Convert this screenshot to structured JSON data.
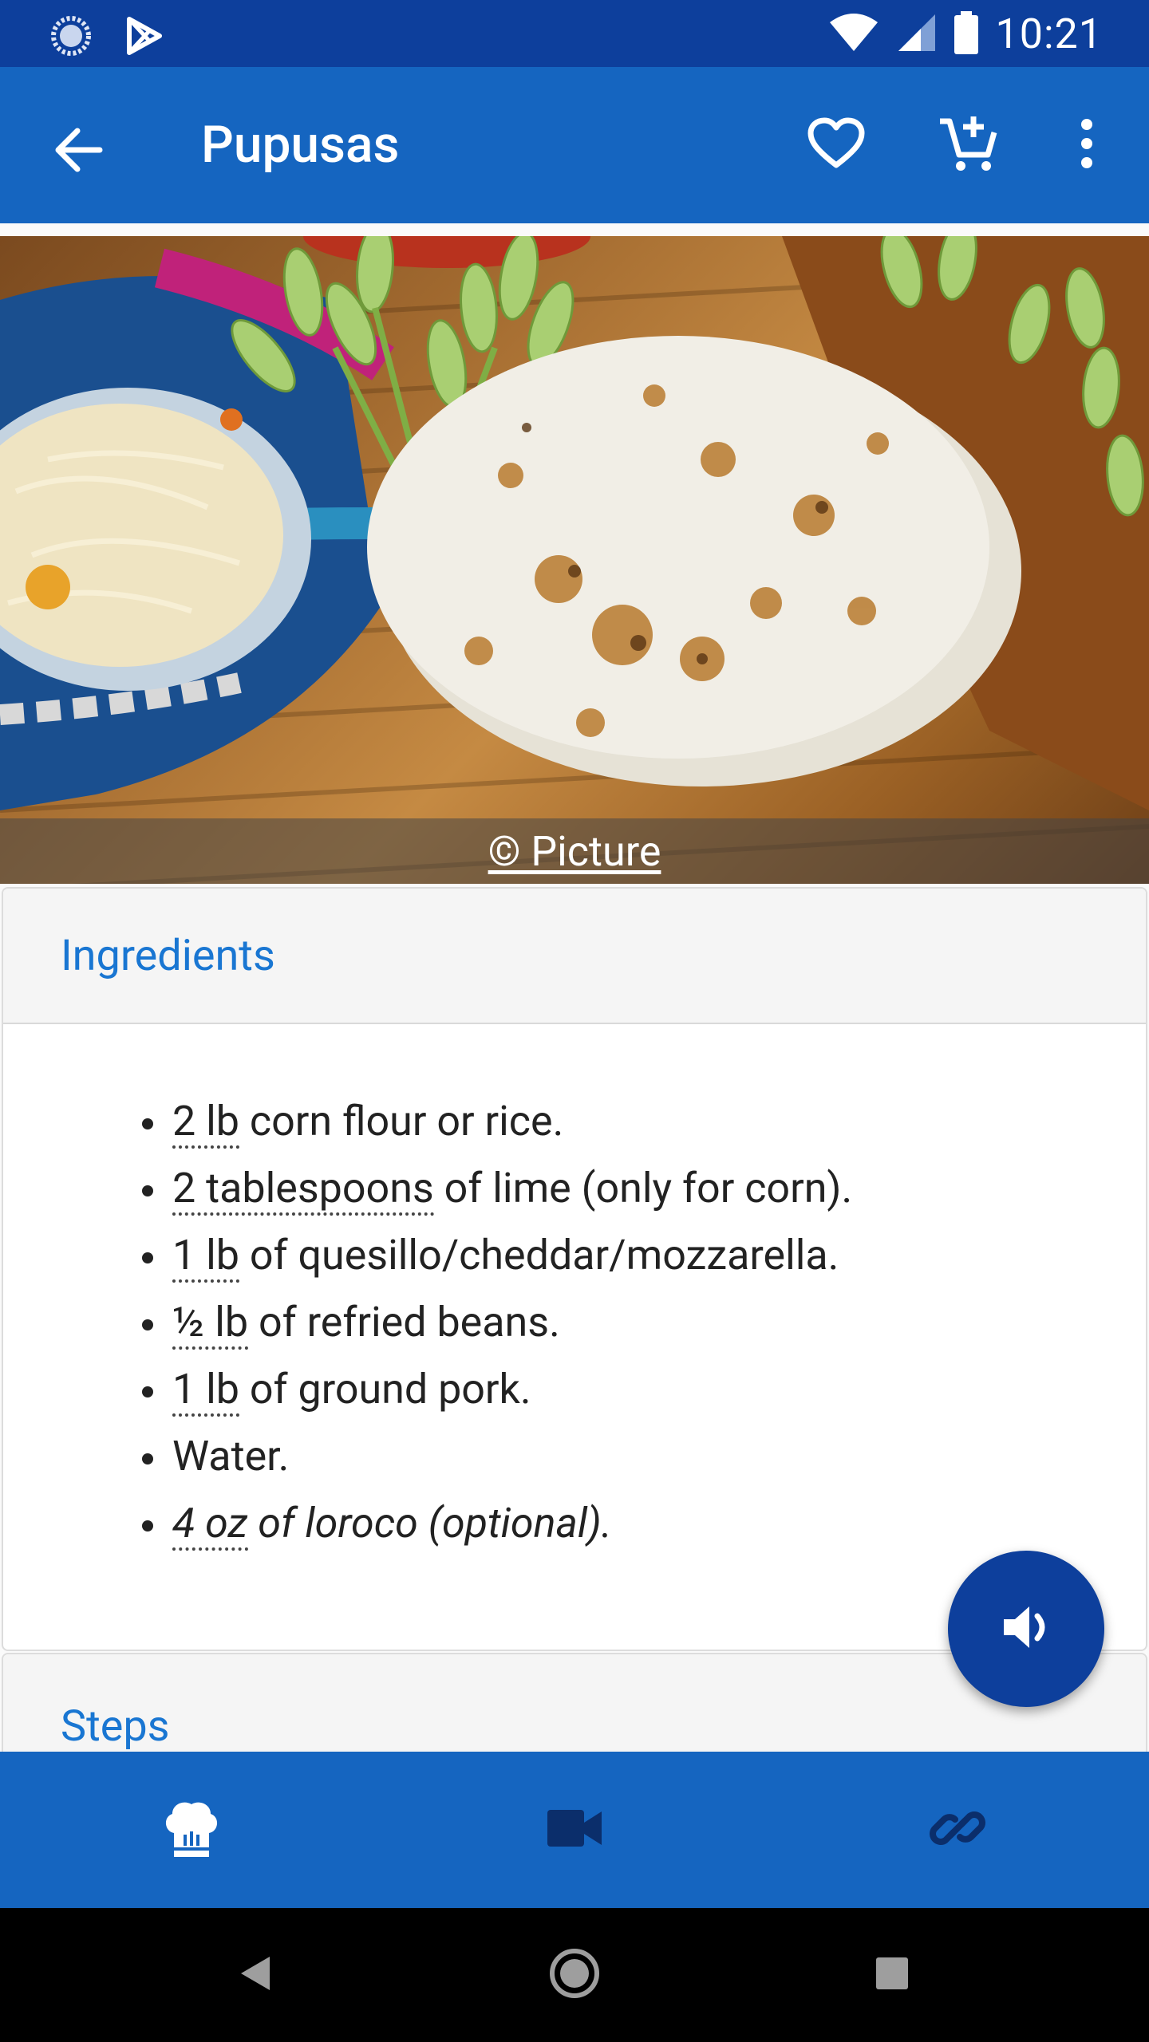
{
  "status_bar": {
    "time": "10:21"
  },
  "app_bar": {
    "title": "Pupusas"
  },
  "hero": {
    "credit_label": "© Picture"
  },
  "ingredients": {
    "header": "Ingredients",
    "items": [
      {
        "qty": "2 lb",
        "text": " corn flour or rice.",
        "italic": false
      },
      {
        "qty": "2 tablespoons",
        "text": " of lime (only for corn).",
        "italic": false
      },
      {
        "qty": "1 lb",
        "text": " of quesillo/cheddar/mozzarella.",
        "italic": false
      },
      {
        "qty": "½ lb",
        "text": " of refried beans.",
        "italic": false
      },
      {
        "qty": "1 lb",
        "text": " of ground pork.",
        "italic": false
      },
      {
        "qty": "",
        "text": "Water.",
        "italic": false
      },
      {
        "qty": "4 oz",
        "text": " of loroco (optional).",
        "italic": true
      }
    ]
  },
  "steps": {
    "header": "Steps"
  },
  "icons": {
    "back": "arrow-back-icon",
    "favorite": "heart-outline-icon",
    "cart": "add-to-cart-icon",
    "more": "more-vert-icon",
    "speak": "volume-icon",
    "recipe": "chef-hat-icon",
    "video": "video-camera-icon",
    "link": "link-icon"
  },
  "colors": {
    "status_bar": "#0d3f9c",
    "app_bar": "#1565c0",
    "accent_text": "#1976d2",
    "fab": "#0d3f9c"
  }
}
